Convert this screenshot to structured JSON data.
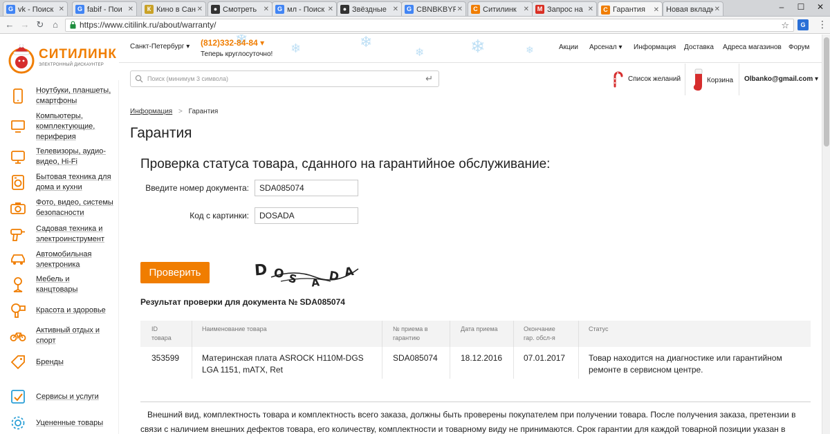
{
  "browser": {
    "tabs": [
      {
        "label": "vk - Поиск",
        "fav": "G",
        "fav_color": "#4285f4"
      },
      {
        "label": "fabif - Пои",
        "fav": "G",
        "fav_color": "#4285f4"
      },
      {
        "label": "Кино в Сан",
        "fav": "К",
        "fav_color": "#c9a227"
      },
      {
        "label": "Смотреть",
        "fav": "●",
        "fav_color": "#333333"
      },
      {
        "label": "мл - Поиск",
        "fav": "G",
        "fav_color": "#4285f4"
      },
      {
        "label": "Звёздные",
        "fav": "●",
        "fav_color": "#333333"
      },
      {
        "label": "CBNBKBYR",
        "fav": "G",
        "fav_color": "#4285f4"
      },
      {
        "label": "Ситилинк",
        "fav": "С",
        "fav_color": "#f07d00"
      },
      {
        "label": "Запрос на",
        "fav": "M",
        "fav_color": "#d93025"
      },
      {
        "label": "Гарантия",
        "fav": "С",
        "fav_color": "#f07d00"
      },
      {
        "label": "Новая вкладка",
        "fav": "",
        "fav_color": "#e6e8eb"
      }
    ],
    "url": "https://www.citilink.ru/about/warranty/",
    "ext_icon_label": "G"
  },
  "header": {
    "logo_name": "СИТИЛИНК",
    "logo_sub": "ЭЛЕКТРОННЫЙ ДИСКАУНТЕР",
    "city": "Санкт-Петербург",
    "phone": "(812)332-84-84",
    "phone_sub": "Теперь круглосуточно!",
    "links": [
      "Акции",
      "Арсенал",
      "Информация",
      "Доставка",
      "Адреса магазинов",
      "Форум"
    ],
    "search_placeholder": "Поиск (минимум 3 символа)",
    "wishlist": "Список желаний",
    "cart": "Корзина",
    "user": "Olbanko@gmail.com"
  },
  "sidebar": {
    "items": [
      {
        "label": "Ноутбуки, планшеты, смартфоны",
        "icon": "phone-icon"
      },
      {
        "label": "Компьютеры, комплектующие, периферия",
        "icon": "monitor-icon"
      },
      {
        "label": "Телевизоры, аудио-видео, Hi-Fi",
        "icon": "tv-icon"
      },
      {
        "label": "Бытовая техника для дома и кухни",
        "icon": "washer-icon"
      },
      {
        "label": "Фото, видео, системы безопасности",
        "icon": "camera-icon"
      },
      {
        "label": "Садовая техника и электроинструмент",
        "icon": "drill-icon"
      },
      {
        "label": "Автомобильная электроника",
        "icon": "car-icon"
      },
      {
        "label": "Мебель и канцтовары",
        "icon": "chair-icon"
      },
      {
        "label": "Красота и здоровье",
        "icon": "hairdryer-icon"
      },
      {
        "label": "Активный отдых и спорт",
        "icon": "bicycle-icon"
      },
      {
        "label": "Бренды",
        "icon": "tag-icon"
      },
      {
        "label": "Сервисы и услуги",
        "icon": "service-icon"
      },
      {
        "label": "Уцененные товары",
        "icon": "gear-icon"
      }
    ]
  },
  "main": {
    "breadcrumb": {
      "parent": "Информация",
      "separator": ">",
      "current": "Гарантия"
    },
    "title": "Гарантия",
    "subtitle": "Проверка статуса товара, сданного на гарантийное обслуживание:",
    "doc_label": "Введите номер документа:",
    "doc_value": "SDA085074",
    "code_label": "Код с картинки:",
    "code_value": "DOSADA",
    "captcha_text": "DOSADA",
    "check_button": "Проверить",
    "result_title": "Результат проверки для документа № SDA085074",
    "table": {
      "headers": [
        [
          "ID",
          "товара"
        ],
        [
          "Наименование товара",
          ""
        ],
        [
          "№ приема в",
          "гарантию"
        ],
        [
          "Дата приема",
          ""
        ],
        [
          "Окончание",
          "гар. обсл-я"
        ],
        [
          "Статус",
          ""
        ]
      ],
      "row": {
        "id": "353599",
        "name": [
          "Материнская плата ASROCK H110M-DGS",
          "LGA 1151, mATX, Ret"
        ],
        "receipt_no": "SDA085074",
        "date": "18.12.2016",
        "end": "07.01.2017",
        "status": [
          "Товар находится на диагностике или гарантийном",
          "ремонте в сервисном центре."
        ]
      }
    },
    "footer_text": "Внешний вид, комплектность товара и комплектность всего заказа, должны быть проверены покупателем при получении товара. После получения заказа, претензии в связи с наличием внешних дефектов товара, его количеству, комплектности и товарному виду не принимаются. Срок гарантии для каждой товарной позиции указан в товарном"
  },
  "colors": {
    "brand": "#f07d00",
    "snow": "#bfe0f5"
  }
}
